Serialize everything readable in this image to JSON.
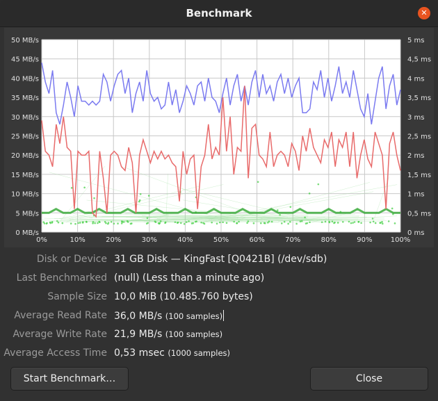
{
  "window": {
    "title": "Benchmark",
    "close_icon": "close-icon"
  },
  "chart_data": {
    "type": "line",
    "x_unit": "percent",
    "x_ticks": [
      "0%",
      "10%",
      "20%",
      "30%",
      "40%",
      "50%",
      "60%",
      "70%",
      "80%",
      "90%",
      "100%"
    ],
    "y_left_ticks": [
      "0 MB/s",
      "5 MB/s",
      "10 MB/s",
      "15 MB/s",
      "20 MB/s",
      "25 MB/s",
      "30 MB/s",
      "35 MB/s",
      "40 MB/s",
      "45 MB/s",
      "50 MB/s"
    ],
    "y_right_ticks": [
      "0 ms",
      "0,5 ms",
      "1 ms",
      "1,5 ms",
      "2 ms",
      "2,5 ms",
      "3 ms",
      "3,5 ms",
      "4 ms",
      "4,5 ms",
      "5 ms"
    ],
    "ylim_left": [
      0,
      50
    ],
    "ylim_right": [
      0,
      5
    ],
    "series": [
      {
        "color": "#7a7af0",
        "x": [
          0,
          1,
          2,
          3,
          4,
          5,
          6,
          7,
          8,
          9,
          10,
          11,
          12,
          13,
          14,
          15,
          16,
          17,
          18,
          19,
          20,
          21,
          22,
          23,
          24,
          25,
          26,
          27,
          28,
          29,
          30,
          31,
          32,
          33,
          34,
          35,
          36,
          37,
          38,
          39,
          40,
          41,
          42,
          43,
          44,
          45,
          46,
          47,
          48,
          49,
          50,
          51,
          52,
          53,
          54,
          55,
          56,
          57,
          58,
          59,
          60,
          61,
          62,
          63,
          64,
          65,
          66,
          67,
          68,
          69,
          70,
          71,
          72,
          73,
          74,
          75,
          76,
          77,
          78,
          79,
          80,
          81,
          82,
          83,
          84,
          85,
          86,
          87,
          88,
          89,
          90,
          91,
          92,
          93,
          94,
          95,
          96,
          97,
          98,
          99
        ],
        "values": [
          44,
          39,
          36,
          42,
          31,
          28,
          33,
          39,
          35,
          30,
          38,
          34,
          34,
          33,
          34,
          33,
          34,
          41,
          39,
          34,
          38,
          41,
          42,
          36,
          40,
          31,
          36,
          39,
          34,
          42,
          36,
          34,
          35,
          32,
          33,
          39,
          33,
          37,
          31,
          34,
          38,
          36,
          33,
          38,
          39,
          34,
          40,
          35,
          34,
          31,
          36,
          40,
          33,
          38,
          41,
          34,
          38,
          33,
          39,
          42,
          35,
          41,
          36,
          38,
          34,
          39,
          41,
          36,
          40,
          35,
          38,
          40,
          31,
          31,
          32,
          39,
          37,
          42,
          35,
          40,
          34,
          38,
          43,
          36,
          39,
          35,
          42,
          37,
          32,
          30,
          36,
          28,
          34,
          40,
          43,
          32,
          38,
          41,
          33,
          37
        ]
      },
      {
        "color": "#e86a6a",
        "x": [
          0,
          1,
          2,
          3,
          4,
          5,
          6,
          7,
          8,
          9,
          10,
          11,
          12,
          13,
          14,
          15,
          16,
          17,
          18,
          19,
          20,
          21,
          22,
          23,
          24,
          25,
          26,
          27,
          28,
          29,
          30,
          31,
          32,
          33,
          34,
          35,
          36,
          37,
          38,
          39,
          40,
          41,
          42,
          43,
          44,
          45,
          46,
          47,
          48,
          49,
          50,
          51,
          52,
          53,
          54,
          55,
          56,
          57,
          58,
          59,
          60,
          61,
          62,
          63,
          64,
          65,
          66,
          67,
          68,
          69,
          70,
          71,
          72,
          73,
          74,
          75,
          76,
          77,
          78,
          79,
          80,
          81,
          82,
          83,
          84,
          85,
          86,
          87,
          88,
          89,
          90,
          91,
          92,
          93,
          94,
          95,
          96,
          97,
          98,
          99
        ],
        "values": [
          29,
          21,
          20,
          17,
          28,
          23,
          30,
          22,
          21,
          6,
          21,
          20,
          20,
          21,
          5,
          4,
          21,
          14,
          5,
          20,
          21,
          20,
          17,
          16,
          22,
          18,
          5,
          20,
          24,
          21,
          18,
          21,
          19,
          21,
          19,
          20,
          18,
          17,
          8,
          21,
          15,
          19,
          20,
          6,
          17,
          20,
          28,
          19,
          22,
          20,
          35,
          21,
          30,
          15,
          22,
          21,
          38,
          14,
          27,
          28,
          20,
          19,
          17,
          26,
          17,
          20,
          21,
          20,
          17,
          23,
          21,
          16,
          25,
          21,
          27,
          22,
          20,
          18,
          24,
          22,
          26,
          17,
          24,
          22,
          26,
          17,
          26,
          14,
          20,
          24,
          19,
          17,
          26,
          23,
          20,
          6,
          23,
          26,
          20,
          16
        ]
      },
      {
        "color": "#3fcf3f",
        "x": [
          0,
          2,
          4,
          6,
          8,
          10,
          12,
          14,
          16,
          18,
          20,
          22,
          24,
          26,
          28,
          30,
          32,
          34,
          36,
          38,
          40,
          42,
          44,
          46,
          48,
          50,
          52,
          54,
          56,
          58,
          60,
          62,
          64,
          66,
          68,
          70,
          72,
          74,
          76,
          78,
          80,
          82,
          84,
          86,
          88,
          90,
          92,
          94,
          96,
          98,
          100
        ],
        "values": [
          0.5,
          0.5,
          0.6,
          0.5,
          0.5,
          0.6,
          0.5,
          0.5,
          0.6,
          0.5,
          0.5,
          0.5,
          0.6,
          0.5,
          0.5,
          0.5,
          0.6,
          0.5,
          0.5,
          0.5,
          0.6,
          0.5,
          0.5,
          0.5,
          0.6,
          0.5,
          0.5,
          0.5,
          0.6,
          0.5,
          0.5,
          0.5,
          0.6,
          0.5,
          0.5,
          0.5,
          0.6,
          0.5,
          0.5,
          0.5,
          0.6,
          0.5,
          0.5,
          0.5,
          0.6,
          0.5,
          0.5,
          0.5,
          0.6,
          0.5,
          0.5
        ]
      }
    ]
  },
  "info": {
    "disk_label": "Disk or Device",
    "disk_value": "31 GB Disk — KingFast [Q0421B] (/dev/sdb)",
    "last_label": "Last Benchmarked",
    "last_value": "(null) (Less than a minute ago)",
    "size_label": "Sample Size",
    "size_value": "10,0 MiB (10.485.760 bytes)",
    "read_label": "Average Read Rate",
    "read_value": "36,0 MB/s",
    "read_sub": "(100 samples)",
    "write_label": "Average Write Rate",
    "write_value": "21,9 MB/s",
    "write_sub": "(100 samples)",
    "access_label": "Average Access Time",
    "access_value": "0,53 msec",
    "access_sub": "(1000 samples)"
  },
  "buttons": {
    "start": "Start Benchmark…",
    "close": "Close"
  }
}
